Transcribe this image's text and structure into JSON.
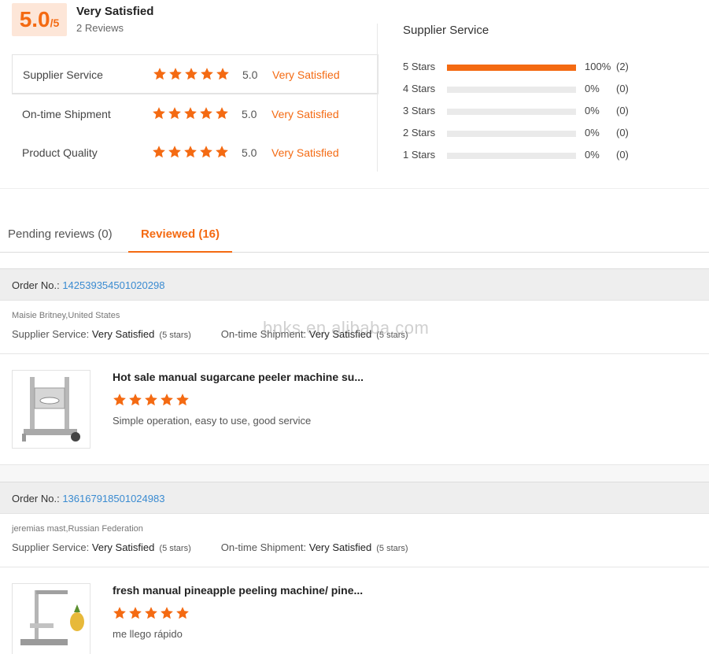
{
  "summary": {
    "score": "5.0",
    "score_max": "/5",
    "label": "Very Satisfied",
    "reviews": "2 Reviews"
  },
  "ratings": [
    {
      "label": "Supplier Service",
      "value": "5.0",
      "word": "Very Satisfied",
      "stars": 5
    },
    {
      "label": "On-time Shipment",
      "value": "5.0",
      "word": "Very Satisfied",
      "stars": 5
    },
    {
      "label": "Product Quality",
      "value": "5.0",
      "word": "Very Satisfied",
      "stars": 5
    }
  ],
  "distribution": {
    "title": "Supplier Service",
    "rows": [
      {
        "label": "5  Stars",
        "percent": "100%",
        "count": "(2)",
        "fraction": 1.0
      },
      {
        "label": "4  Stars",
        "percent": "0%",
        "count": "(0)",
        "fraction": 0
      },
      {
        "label": "3  Stars",
        "percent": "0%",
        "count": "(0)",
        "fraction": 0
      },
      {
        "label": "2  Stars",
        "percent": "0%",
        "count": "(0)",
        "fraction": 0
      },
      {
        "label": "1  Stars",
        "percent": "0%",
        "count": "(0)",
        "fraction": 0
      }
    ]
  },
  "tabs": {
    "pending": "Pending reviews (0)",
    "reviewed": "Reviewed (16)"
  },
  "orders": [
    {
      "order_label": "Order No.:",
      "order_no": "142539354501020298",
      "buyer": "Maisie Britney,United States",
      "supplier_label": "Supplier Service:",
      "supplier_value": "Very Satisfied",
      "supplier_stars": "(5 stars)",
      "shipment_label": "On-time Shipment:",
      "shipment_value": "Very Satisfied",
      "shipment_stars": "(5 stars)",
      "product_title": "Hot sale manual sugarcane peeler machine su...",
      "rating": 5,
      "comment": "Simple operation, easy to use, good service"
    },
    {
      "order_label": "Order No.:",
      "order_no": "136167918501024983",
      "buyer": "jeremias mast,Russian Federation",
      "supplier_label": "Supplier Service:",
      "supplier_value": "Very Satisfied",
      "supplier_stars": "(5 stars)",
      "shipment_label": "On-time Shipment:",
      "shipment_value": "Very Satisfied",
      "shipment_stars": "(5 stars)",
      "product_title": "fresh manual pineapple peeling machine/ pine...",
      "rating": 5,
      "comment": "me llego rápido"
    }
  ],
  "watermark": "bnks.en.alibaba.com",
  "colors": {
    "accent": "#f46a12",
    "link": "#3a8bd1",
    "score_bg": "#fde6d8"
  }
}
